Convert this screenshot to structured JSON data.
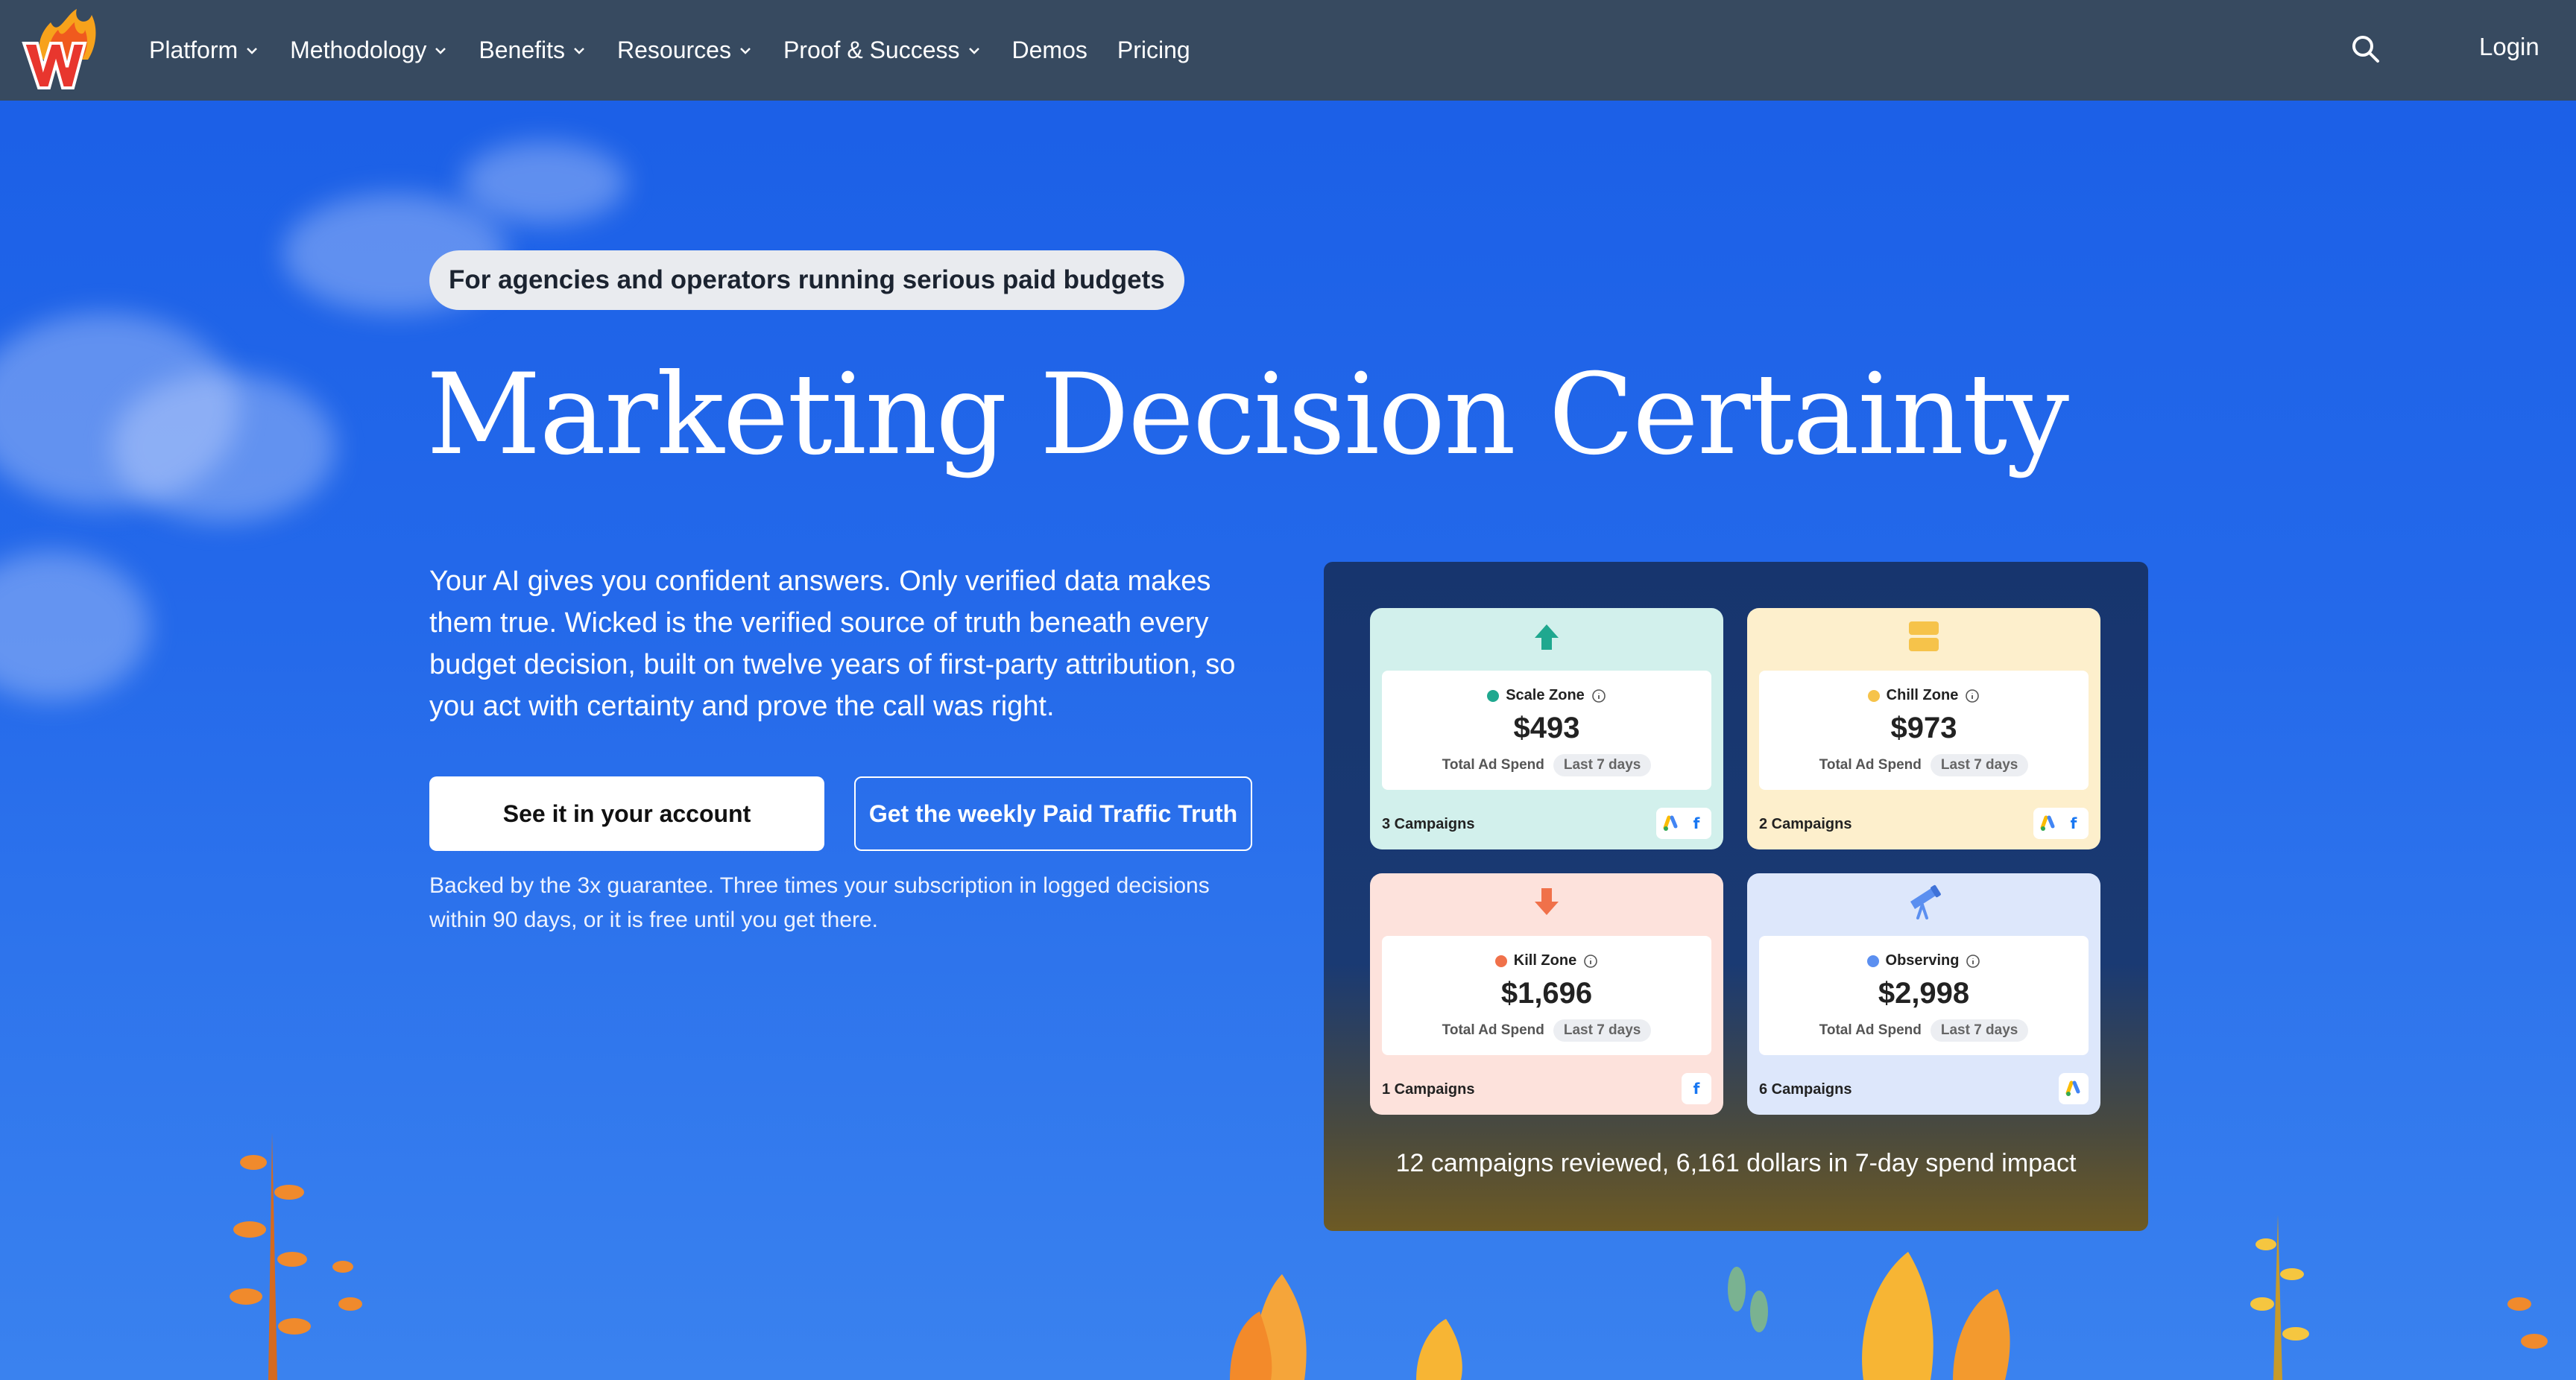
{
  "nav": {
    "items": [
      {
        "label": "Platform",
        "dropdown": true
      },
      {
        "label": "Methodology",
        "dropdown": true
      },
      {
        "label": "Benefits",
        "dropdown": true
      },
      {
        "label": "Resources",
        "dropdown": true
      },
      {
        "label": "Proof & Success",
        "dropdown": true
      },
      {
        "label": "Demos",
        "dropdown": false
      },
      {
        "label": "Pricing",
        "dropdown": false
      }
    ],
    "search_icon": "search-icon",
    "login_label": "Login"
  },
  "hero": {
    "pill": "For agencies and operators running serious paid budgets",
    "headline": "Marketing Decision Certainty",
    "lede": "Your AI gives you confident answers. Only verified data makes them true. Wicked is the verified source of truth beneath every budget decision, built on twelve years of first-party attribution, so you act with certainty and prove the call was right.",
    "primary_cta": "See it in your account",
    "secondary_cta": "Get the weekly Paid Traffic Truth",
    "guarantee": "Backed by the 3x guarantee. Three times your subscription in logged decisions within 90 days, or it is free until you get there."
  },
  "dashboard": {
    "cards": [
      {
        "zone": "Scale Zone",
        "amount": "$493",
        "spend_label": "Total Ad Spend",
        "period": "Last 7 days",
        "campaigns": "3 Campaigns",
        "bg": "#d2f0ec",
        "dot": "#1fa88f",
        "icon": "arrow-up-icon",
        "platforms": [
          "google-ads-icon",
          "facebook-icon"
        ]
      },
      {
        "zone": "Chill Zone",
        "amount": "$973",
        "spend_label": "Total Ad Spend",
        "period": "Last 7 days",
        "campaigns": "2 Campaigns",
        "bg": "#fdefcc",
        "dot": "#f6c34a",
        "icon": "pause-icon",
        "platforms": [
          "google-ads-icon",
          "facebook-icon"
        ]
      },
      {
        "zone": "Kill Zone",
        "amount": "$1,696",
        "spend_label": "Total Ad Spend",
        "period": "Last 7 days",
        "campaigns": "1 Campaigns",
        "bg": "#fde2dc",
        "dot": "#f0714a",
        "icon": "arrow-down-icon",
        "platforms": [
          "facebook-icon"
        ]
      },
      {
        "zone": "Observing",
        "amount": "$2,998",
        "spend_label": "Total Ad Spend",
        "period": "Last 7 days",
        "campaigns": "6 Campaigns",
        "bg": "#dde7fb",
        "dot": "#5b8ff0",
        "icon": "telescope-icon",
        "platforms": [
          "google-ads-icon"
        ]
      }
    ],
    "summary": "12 campaigns reviewed, 6,161 dollars in 7-day spend impact"
  }
}
